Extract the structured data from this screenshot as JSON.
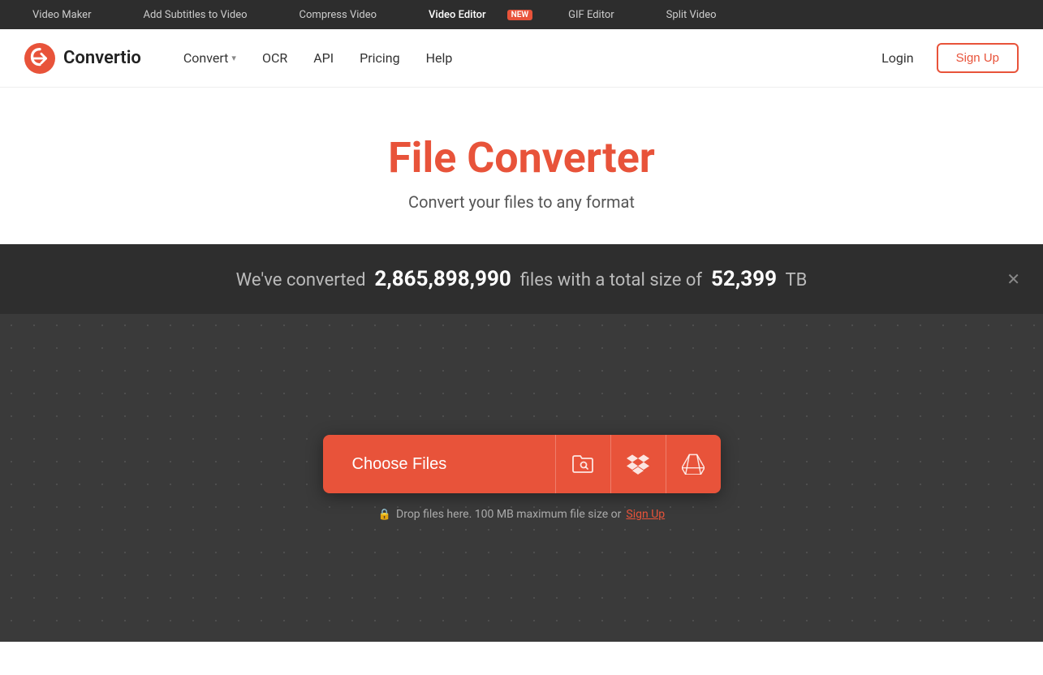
{
  "topbar": {
    "links": [
      {
        "id": "video-maker",
        "label": "Video Maker",
        "active": false
      },
      {
        "id": "add-subtitles",
        "label": "Add Subtitles to Video",
        "active": false
      },
      {
        "id": "compress-video",
        "label": "Compress Video",
        "active": false
      },
      {
        "id": "video-editor",
        "label": "Video Editor",
        "active": true,
        "badge": "NEW"
      },
      {
        "id": "gif-editor",
        "label": "GIF Editor",
        "active": false
      },
      {
        "id": "split-video",
        "label": "Split Video",
        "active": false
      }
    ]
  },
  "header": {
    "logo_text": "Convertio",
    "nav": [
      {
        "id": "convert",
        "label": "Convert",
        "has_arrow": true
      },
      {
        "id": "ocr",
        "label": "OCR",
        "has_arrow": false
      },
      {
        "id": "api",
        "label": "API",
        "has_arrow": false
      },
      {
        "id": "pricing",
        "label": "Pricing",
        "has_arrow": false
      },
      {
        "id": "help",
        "label": "Help",
        "has_arrow": false
      }
    ],
    "login_label": "Login",
    "signup_label": "Sign Up"
  },
  "hero": {
    "title": "File Converter",
    "subtitle": "Convert your files to any format"
  },
  "stats": {
    "prefix": "We've converted",
    "file_count": "2,865,898,990",
    "middle": "files with a total size of",
    "size": "52,399",
    "suffix": "TB"
  },
  "upload": {
    "choose_files_label": "Choose Files",
    "drop_hint_prefix": "Drop files here. 100 MB maximum file size or",
    "signup_link": "Sign Up",
    "icons": {
      "folder_search": "🗂",
      "dropbox": "dropbox",
      "gdrive": "gdrive"
    }
  },
  "colors": {
    "brand_red": "#e8533a",
    "dark_bg": "#3a3a3a",
    "darker_bg": "#2e2e2e"
  }
}
